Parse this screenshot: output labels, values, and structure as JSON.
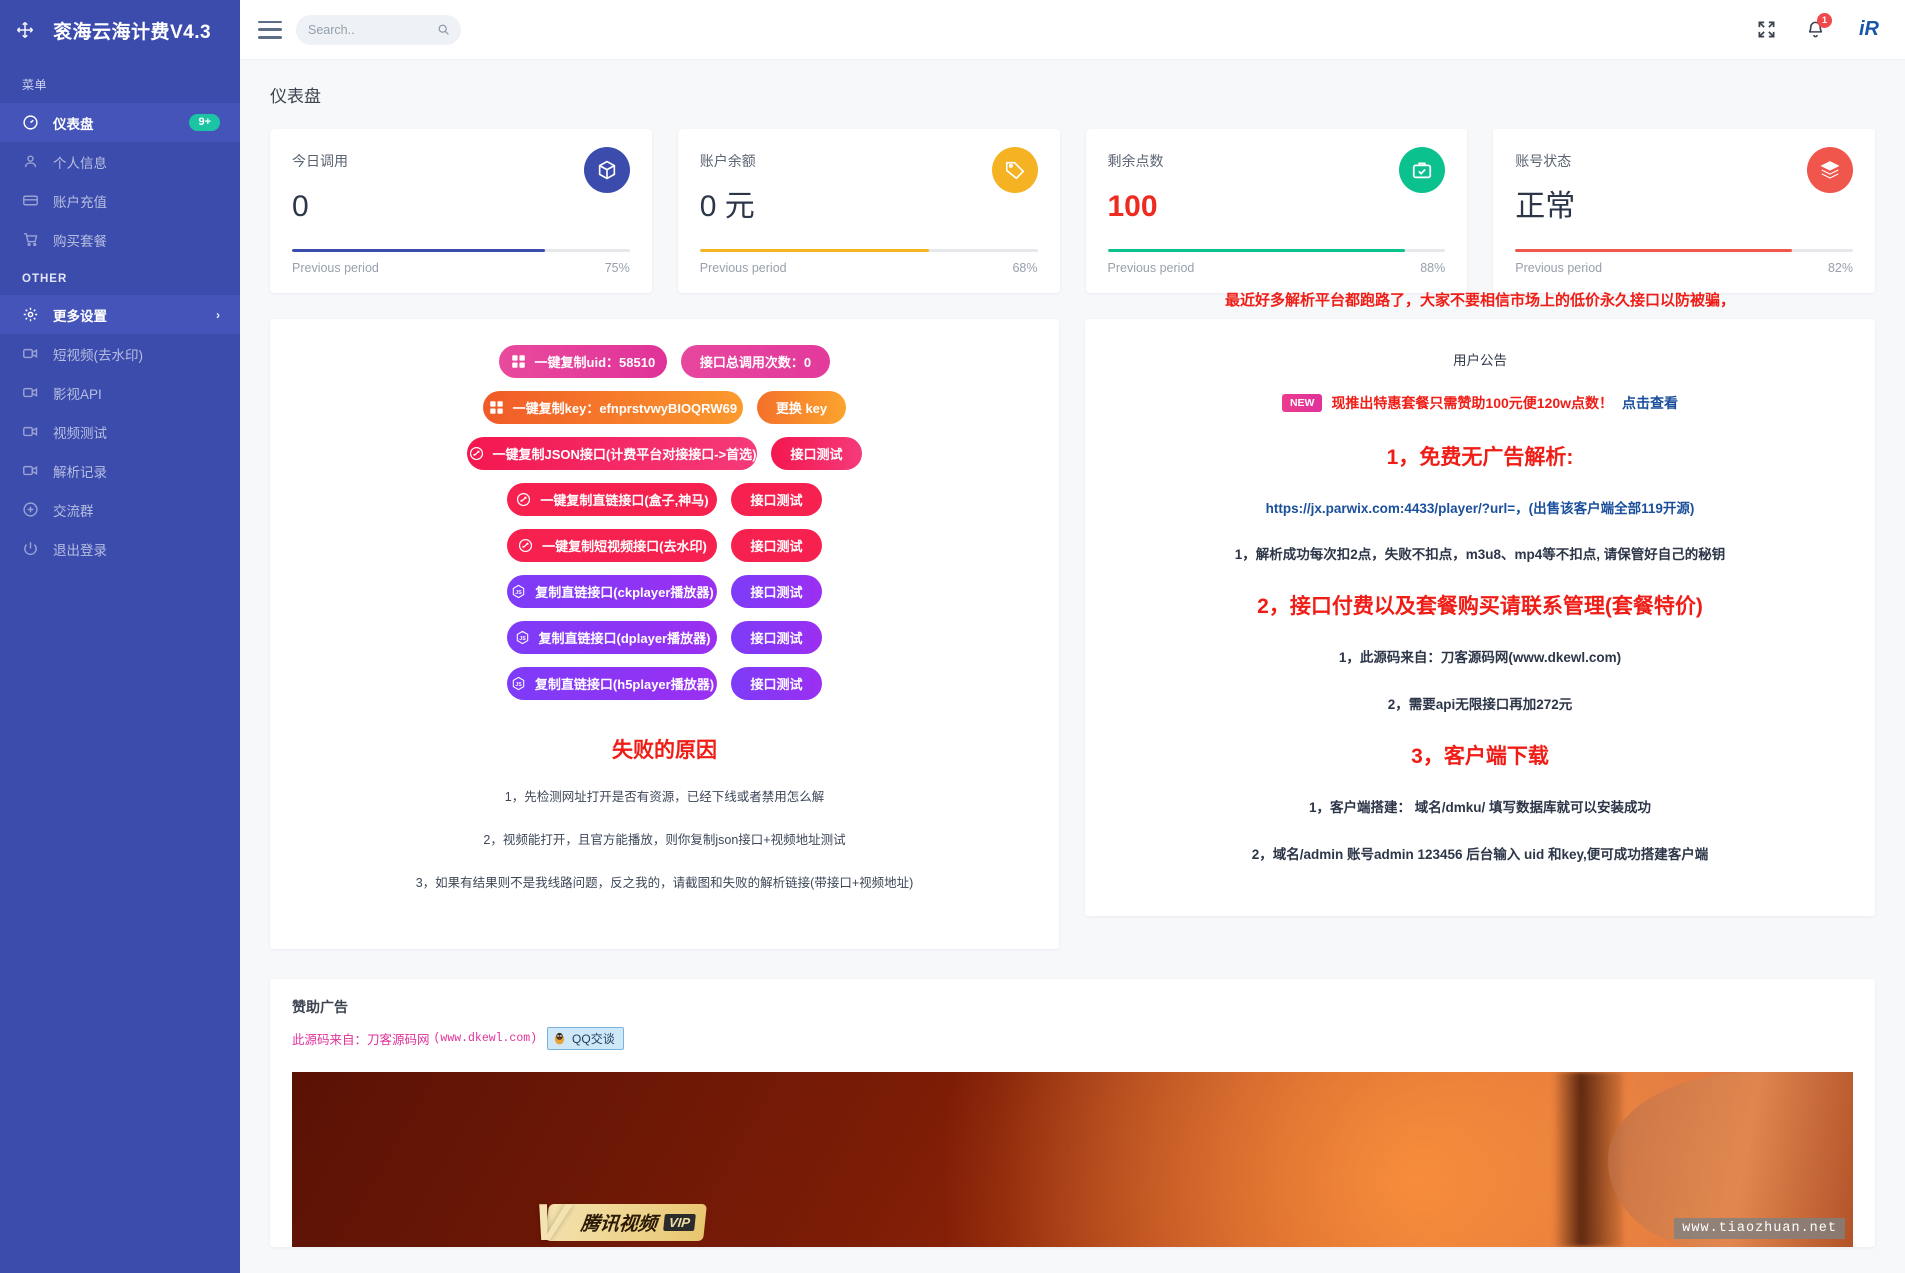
{
  "brand": {
    "title": "衮海云海计费V4.3",
    "move_icon": "move-icon"
  },
  "sidebar": {
    "section_menu": "菜单",
    "section_other": "OTHER",
    "items": [
      {
        "label": "仪表盘",
        "icon": "dashboard-icon",
        "active": true,
        "badge": "9+"
      },
      {
        "label": "个人信息",
        "icon": "user-icon"
      },
      {
        "label": "账户充值",
        "icon": "card-icon"
      },
      {
        "label": "购买套餐",
        "icon": "cart-icon"
      }
    ],
    "other_items": [
      {
        "label": "更多设置",
        "icon": "gear-icon",
        "active": true,
        "chevron": "›"
      },
      {
        "label": "短视频(去水印)",
        "icon": "video-icon"
      },
      {
        "label": "影视API",
        "icon": "video-icon"
      },
      {
        "label": "视频测试",
        "icon": "video-icon"
      },
      {
        "label": "解析记录",
        "icon": "video-icon"
      },
      {
        "label": "交流群",
        "icon": "plus-circle-icon"
      },
      {
        "label": "退出登录",
        "icon": "power-icon"
      }
    ]
  },
  "topbar": {
    "search_placeholder": "Search..",
    "search_value": "",
    "notification_count": "1",
    "avatar_glyph": "iR"
  },
  "page": {
    "title": "仪表盘"
  },
  "stats": [
    {
      "label": "今日调用",
      "value": "0",
      "percent": "75%",
      "bar": 75,
      "color": "#3c4cad",
      "icon": "cube-icon",
      "value_red": false
    },
    {
      "label": "账户余额",
      "value": "0 元",
      "percent": "68%",
      "bar": 68,
      "color": "#f5b324",
      "icon": "tag-icon",
      "value_red": false
    },
    {
      "label": "剩余点数",
      "value": "100",
      "percent": "88%",
      "bar": 88,
      "color": "#0bc18e",
      "icon": "briefcase-check-icon",
      "value_red": true
    },
    {
      "label": "账号状态",
      "value": "正常",
      "percent": "82%",
      "bar": 82,
      "color": "#f0564b",
      "icon": "layers-icon",
      "value_red": false
    }
  ],
  "stats_footer_label": "Previous period",
  "actions": {
    "row1": {
      "copy_uid": "一键复制uid：58510",
      "total_calls": "接口总调用次数：0"
    },
    "row2": {
      "copy_key": "一键复制key：efnprstvwyBIOQRW69",
      "change_key": "更换 key"
    },
    "row3": {
      "copy_json": "一键复制JSON接口(计费平台对接接口->首选)",
      "test": "接口测试"
    },
    "row4": {
      "copy_direct": "一键复制直链接口(盒子,神马)",
      "test": "接口测试"
    },
    "row5": {
      "copy_short": "一键复制短视频接口(去水印)",
      "test": "接口测试"
    },
    "row6": {
      "copy_ck": "复制直链接口(ckplayer播放器)",
      "test": "接口测试"
    },
    "row7": {
      "copy_dp": "复制直链接口(dplayer播放器)",
      "test": "接口测试"
    },
    "row8": {
      "copy_h5": "复制直链接口(h5player播放器)",
      "test": "接口测试"
    }
  },
  "failure": {
    "title": "失败的原因",
    "lines": [
      "1，先检测网址打开是否有资源，已经下线或者禁用怎么解",
      "2，视频能打开，且官方能播放，则你复制json接口+视频地址测试",
      "3，如果有结果则不是我线路问题，反之我的，请截图和失败的解析链接(带接口+视频地址)"
    ]
  },
  "announcement": {
    "marquee": "最近好多解析平台都跑路了，大家不要相信市场上的低价永久接口以防被骗，",
    "title": "用户公告",
    "new_tag": "NEW",
    "new_text": "现推出特惠套餐只需赞助100元便120w点数！",
    "new_link": "点击查看",
    "h1": "1，免费无广告解析:",
    "url_line": "https://jx.parwix.com:4433/player/?url=，(出售该客户端全部119开源)",
    "line1": "1，解析成功每次扣2点，失败不扣点，m3u8、mp4等不扣点, 请保管好自己的秘钥",
    "h2": "2，接口付费以及套餐购买请联系管理(套餐特价)",
    "line2": "1，此源码来自：刀客源码网(www.dkewl.com)",
    "line3": "2，需要api无限接口再加272元",
    "h3": "3，客户端下载",
    "line4": "1，客户端搭建： 域名/dmku/ 填写数据库就可以安装成功",
    "line5": "2，域名/admin 账号admin 123456 后台输入 uid 和key,便可成功搭建客户端"
  },
  "sponsor": {
    "title": "赞助广告",
    "source_cn": "此源码来自：刀客源码网",
    "source_url": "(www.dkewl.com)",
    "qq_label": "QQ交谈",
    "banner": {
      "vip_v": "V",
      "vip_cn": "腾讯视频",
      "vip_tag": "VIP"
    },
    "watermark": "www.tiaozhuan.net"
  }
}
